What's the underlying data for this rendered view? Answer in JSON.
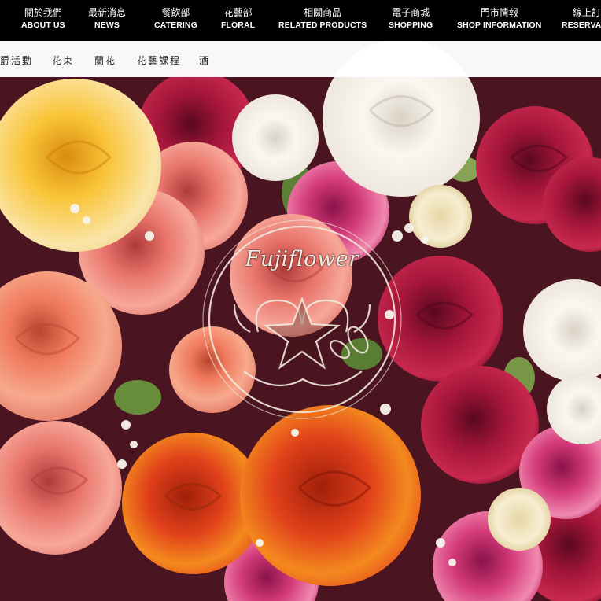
{
  "nav": [
    {
      "zh": "關於我們",
      "en": "ABOUT US"
    },
    {
      "zh": "最新消息",
      "en": "NEWS"
    },
    {
      "zh": "餐飲部",
      "en": "CATERING"
    },
    {
      "zh": "花藝部",
      "en": "FLORAL"
    },
    {
      "zh": "相關商品",
      "en": "RELATED PRODUCTS"
    },
    {
      "zh": "電子商城",
      "en": "SHOPPING"
    },
    {
      "zh": "門市情報",
      "en": "SHOP INFORMATION"
    },
    {
      "zh": "線上訂",
      "en": "RESERVAT"
    }
  ],
  "subnav": [
    "爵活動",
    "花束",
    "蘭花",
    "花藝課程",
    "酒"
  ],
  "logo": {
    "text": "Fujiflower"
  }
}
